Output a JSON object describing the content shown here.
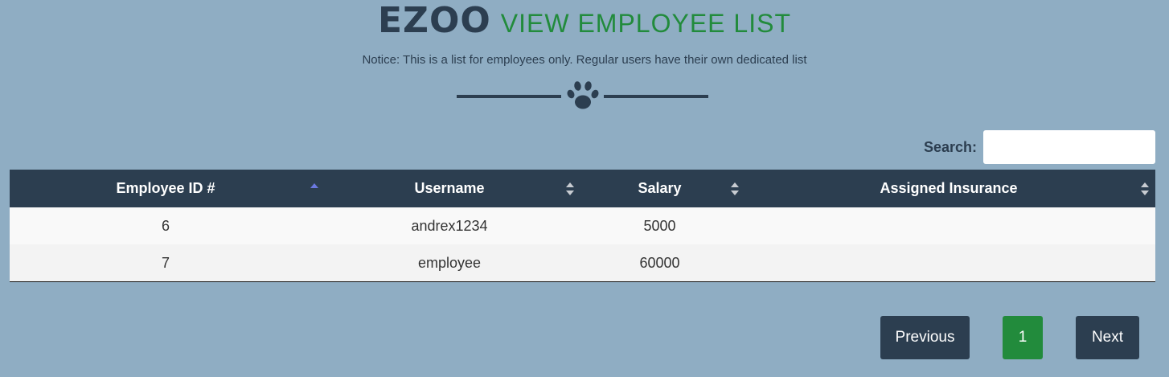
{
  "header": {
    "brand": "EZOO",
    "subtitle": "VIEW EMPLOYEE LIST",
    "notice": "Notice: This is a list for employees only. Regular users have their own dedicated list"
  },
  "divider": {
    "icon": "paw-icon"
  },
  "search": {
    "label": "Search:",
    "value": "",
    "placeholder": ""
  },
  "table": {
    "columns": [
      {
        "label": "Employee ID #",
        "sort": "ascending"
      },
      {
        "label": "Username",
        "sort": "none"
      },
      {
        "label": "Salary",
        "sort": "none"
      },
      {
        "label": "Assigned Insurance",
        "sort": "none"
      }
    ],
    "rows": [
      {
        "id": "6",
        "username": "andrex1234",
        "salary": "5000",
        "insurance": ""
      },
      {
        "id": "7",
        "username": "employee",
        "salary": "60000",
        "insurance": ""
      }
    ]
  },
  "pagination": {
    "previous_label": "Previous",
    "current_page": "1",
    "next_label": "Next"
  },
  "colors": {
    "background": "#8fadc3",
    "navy": "#2c3e50",
    "accent_green": "#228b3c",
    "sort_active": "#6b78e0"
  }
}
